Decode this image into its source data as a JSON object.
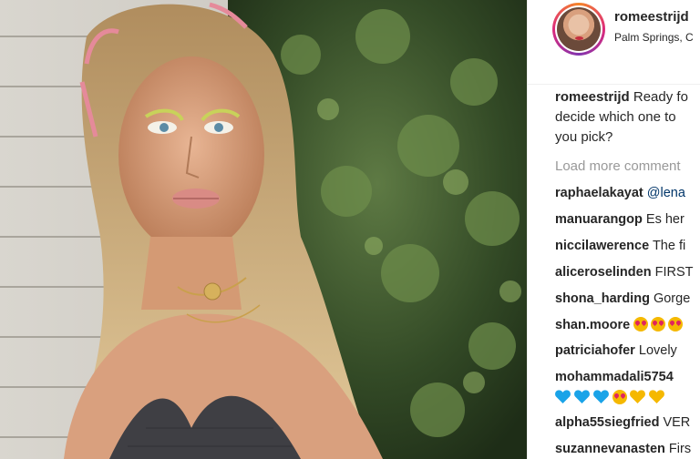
{
  "post": {
    "username": "romeestrijd",
    "location": "Palm Springs, C",
    "caption_user": "romeestrijd",
    "caption_lines": [
      "Ready fo",
      "decide which one to",
      "you pick?"
    ],
    "load_more": "Load more comment"
  },
  "comments": [
    {
      "user": "raphaelakayat",
      "text": "@lena",
      "mention": true
    },
    {
      "user": "manuarangop",
      "text": "Es her"
    },
    {
      "user": "niccilawerence",
      "text": "The fi"
    },
    {
      "user": "aliceroselinden",
      "text": "FIRST"
    },
    {
      "user": "shona_harding",
      "text": "Gorge"
    },
    {
      "user": "shan.moore",
      "emojis": [
        "heart-eyes-emoji",
        "heart-eyes-emoji",
        "heart-eyes-emoji"
      ]
    },
    {
      "user": "patriciahofer",
      "text": "Lovely"
    },
    {
      "user": "mohammadali5754",
      "text": "",
      "hearts": [
        "#1aa3e8",
        "#1aa3e8",
        "#1aa3e8",
        "kiss",
        "#f5b800",
        "#f5b800"
      ]
    },
    {
      "user": "alpha55siegfried",
      "text": "VER"
    },
    {
      "user": "suzannevanasten",
      "text": "Firs"
    }
  ],
  "colors": {
    "text": "#262626",
    "muted": "#999999",
    "mention": "#003569"
  }
}
